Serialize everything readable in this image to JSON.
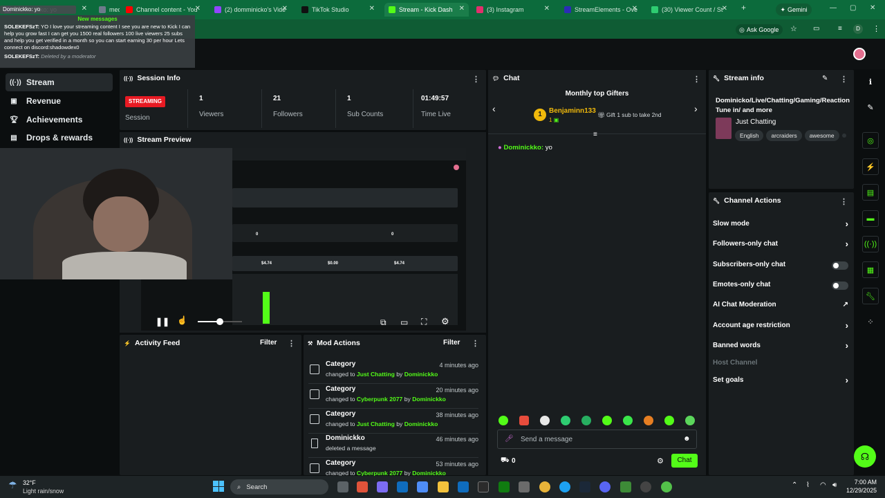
{
  "browser": {
    "tabs": [
      {
        "title": "Dominickko: yo",
        "color": "#9b59b6"
      },
      {
        "title": "media",
        "color": "#6e7b8c"
      },
      {
        "title": "Channel content - You",
        "color": "#ff0000"
      },
      {
        "title": "(2) domminicko's Vide",
        "color": "#9146ff"
      },
      {
        "title": "TikTok Studio",
        "color": "#111111"
      },
      {
        "title": "Stream - Kick Dash",
        "color": "#53fc18"
      },
      {
        "title": "(3) Instagram",
        "color": "#e1306c"
      },
      {
        "title": "StreamElements - Ove",
        "color": "#2b2cb6"
      },
      {
        "title": "(30) Viewer Count / St",
        "color": "#2ecc71"
      }
    ],
    "gemini_label": "Gemini",
    "ask_google_label": "Ask Google",
    "new_tab": "+",
    "window_controls": [
      "—",
      "▢",
      "✕"
    ],
    "profile_initial": "D"
  },
  "notification": {
    "tiny_text": "Dominickko: yo",
    "new_messages": "New messages",
    "message_user": "SOLEKEFSzT:",
    "message_text": "YO I love your streaming content I see you are new to Kick I can help you grow fast I can get you 1500 real followers 100 live viewers 25 subs and help you get verified in a month so you can start earning 30 per hour Lets connect on discord:shadowdex0",
    "deleted_user": "SOLEKEFSzT:",
    "deleted_text": "Deleted by a moderator"
  },
  "nav": {
    "items": [
      {
        "label": "Stream",
        "icon": "signal-icon"
      },
      {
        "label": "Revenue",
        "icon": "revenue-icon"
      },
      {
        "label": "Achievements",
        "icon": "trophy-icon"
      },
      {
        "label": "Drops & rewards",
        "icon": "gift-icon"
      }
    ]
  },
  "session": {
    "title": "Session Info",
    "status_badge": "STREAMING",
    "status_label": "Session",
    "stats": [
      {
        "value": "1",
        "label": "Viewers"
      },
      {
        "value": "21",
        "label": "Followers"
      },
      {
        "value": "1",
        "label": "Sub Counts"
      },
      {
        "value": "01:49:57",
        "label": "Time Live"
      }
    ]
  },
  "preview": {
    "title": "Stream Preview",
    "embedded_values": [
      "0",
      "0",
      "$4.74",
      "$0.00",
      "$4.74"
    ],
    "volume_level": 0.5
  },
  "activity": {
    "title": "Activity Feed",
    "filter_label": "Filter"
  },
  "mod_actions": {
    "title": "Mod Actions",
    "filter_label": "Filter",
    "items": [
      {
        "title": "Category",
        "pre": "changed to",
        "target": "Just Chatting",
        "mid": "by",
        "user": "Dominickko",
        "time": "4 minutes ago"
      },
      {
        "title": "Category",
        "pre": "changed to",
        "target": "Cyberpunk 2077",
        "mid": "by",
        "user": "Dominickko",
        "time": "20 minutes ago"
      },
      {
        "title": "Category",
        "pre": "changed to",
        "target": "Just Chatting",
        "mid": "by",
        "user": "Dominickko",
        "time": "38 minutes ago"
      },
      {
        "title": "Dominickko",
        "pre": "deleted a message",
        "target": "",
        "mid": "",
        "user": "",
        "time": "46 minutes ago"
      },
      {
        "title": "Category",
        "pre": "changed to",
        "target": "Cyberpunk 2077",
        "mid": "by",
        "user": "Dominickko",
        "time": "53 minutes ago"
      }
    ]
  },
  "chat": {
    "title": "Chat",
    "gifters_title": "Monthly top Gifters",
    "top_gifter": "Benjaminn133",
    "top_gifter_rank": "1",
    "top_gifter_count": "1",
    "gift_hint": "Gift 1 sub to take 2nd",
    "messages": [
      {
        "user": "Dominickko:",
        "text": "yo"
      }
    ],
    "input_placeholder": "Send a message",
    "points": "0",
    "send_label": "Chat"
  },
  "stream_info": {
    "title": "Stream info",
    "stream_title": "Dominicko/Live/Chatting/Gaming/Reaction Tune in/ and more",
    "category": "Just Chatting",
    "tags": [
      "English",
      "arcraiders",
      "awesome"
    ]
  },
  "channel_actions": {
    "title": "Channel Actions",
    "items": [
      {
        "label": "Slow mode",
        "control": "chevron"
      },
      {
        "label": "Followers-only chat",
        "control": "chevron"
      },
      {
        "label": "Subscribers-only chat",
        "control": "toggle"
      },
      {
        "label": "Emotes-only chat",
        "control": "toggle"
      },
      {
        "label": "AI Chat Moderation",
        "control": "external"
      },
      {
        "label": "Account age restriction",
        "control": "chevron"
      },
      {
        "label": "Banned words",
        "control": "chevron"
      },
      {
        "label": "Host Channel",
        "control": "none"
      },
      {
        "label": "Set goals",
        "control": "chevron"
      }
    ]
  },
  "taskbar": {
    "weather_temp": "32°F",
    "weather_desc": "Light rain/snow",
    "search_label": "Search",
    "time": "7:00 AM",
    "date": "12/29/2025"
  },
  "colors": {
    "accent": "#53fc18",
    "streaming": "#e81a23",
    "gifter": "#f0b90b"
  }
}
